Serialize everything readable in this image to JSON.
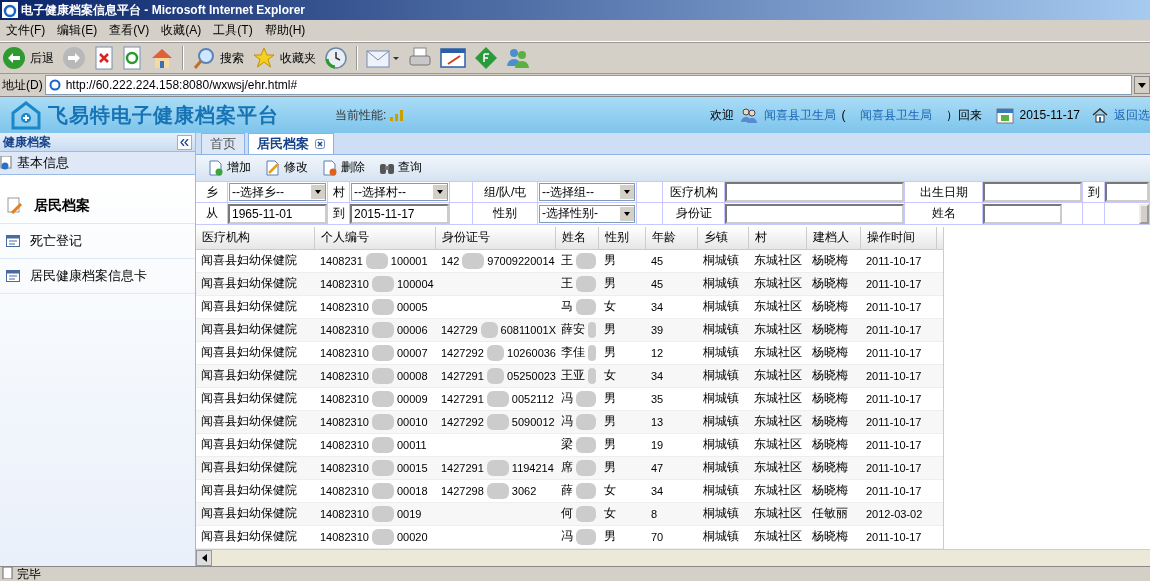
{
  "window": {
    "title": "电子健康档案信息平台 - Microsoft Internet Explorer"
  },
  "menu": [
    "文件(F)",
    "编辑(E)",
    "查看(V)",
    "收藏(A)",
    "工具(T)",
    "帮助(H)"
  ],
  "toolbar": [
    {
      "kind": "back",
      "label": "后退"
    },
    {
      "kind": "forward"
    },
    {
      "kind": "stop"
    },
    {
      "kind": "refresh"
    },
    {
      "kind": "home"
    },
    {
      "kind": "search",
      "label": "搜索"
    },
    {
      "kind": "favorites",
      "label": "收藏夹"
    },
    {
      "kind": "history"
    },
    {
      "kind": "mail"
    },
    {
      "kind": "print"
    },
    {
      "kind": "edit"
    },
    {
      "kind": "plugin"
    },
    {
      "kind": "messenger"
    }
  ],
  "address": {
    "label": "地址(D)",
    "url": "http://60.222.224.158:8080/wxwsj/ehr.html#"
  },
  "header": {
    "logo_text": "飞易特电子健康档案平台",
    "performance_label": "当前性能:",
    "welcome": "欢迎",
    "user": "闻喜县卫生局",
    "paren_open": "(",
    "org": "闻喜县卫生局",
    "paren_close": "）回来",
    "date": "2015-11-17",
    "back_link": "返回选"
  },
  "sidebar": {
    "title": "健康档案",
    "group": "基本信息",
    "items": [
      {
        "label": "居民档案",
        "selected": true
      },
      {
        "label": "死亡登记",
        "selected": false
      },
      {
        "label": "居民健康档案信息卡",
        "selected": false
      }
    ]
  },
  "tabs": [
    {
      "label": "首页",
      "selected": false,
      "closable": false
    },
    {
      "label": "居民档案",
      "selected": true,
      "closable": true
    }
  ],
  "actions": [
    {
      "kind": "add",
      "label": "增加"
    },
    {
      "kind": "edit",
      "label": "修改"
    },
    {
      "kind": "delete",
      "label": "删除"
    },
    {
      "kind": "query",
      "label": "查询"
    }
  ],
  "filters": [
    [
      {
        "kind": "label",
        "text": "乡"
      },
      {
        "kind": "select",
        "value": "--选择乡--"
      },
      {
        "kind": "label",
        "text": "村"
      },
      {
        "kind": "select",
        "value": "--选择村--"
      },
      {
        "kind": "blank"
      },
      {
        "kind": "label",
        "text": "组/队/屯"
      },
      {
        "kind": "select",
        "value": "--选择组--"
      },
      {
        "kind": "blank"
      },
      {
        "kind": "label",
        "text": "医疗机构"
      },
      {
        "kind": "input"
      },
      {
        "kind": "label",
        "text": "出生日期"
      },
      {
        "kind": "input"
      },
      {
        "kind": "label",
        "text": "到"
      },
      {
        "kind": "input"
      }
    ],
    [
      {
        "kind": "label",
        "text": "从"
      },
      {
        "kind": "input",
        "value": "1965-11-01"
      },
      {
        "kind": "label",
        "text": "到"
      },
      {
        "kind": "input",
        "value": "2015-11-17"
      },
      {
        "kind": "blank"
      },
      {
        "kind": "label",
        "text": "性别"
      },
      {
        "kind": "select",
        "value": "-选择性别-"
      },
      {
        "kind": "blank"
      },
      {
        "kind": "label",
        "text": "身份证"
      },
      {
        "kind": "input"
      },
      {
        "kind": "label",
        "text": "姓名"
      },
      {
        "kind": "input"
      },
      {
        "kind": "blank"
      },
      {
        "kind": "button"
      }
    ]
  ],
  "table": {
    "columns": [
      "医疗机构",
      "个人编号",
      "身份证号",
      "姓名",
      "性别",
      "年龄",
      "乡镇",
      "村",
      "建档人",
      "操作时间"
    ],
    "rows": [
      [
        "闻喜县妇幼保健院",
        [
          "1408231",
          "100001"
        ],
        [
          "142",
          "97009220014"
        ],
        "王",
        "男",
        "45",
        "桐城镇",
        "东城社区",
        "杨晓梅",
        "2011-10-17"
      ],
      [
        "闻喜县妇幼保健院",
        [
          "14082310",
          "100004"
        ],
        [],
        "王",
        "男",
        "45",
        "桐城镇",
        "东城社区",
        "杨晓梅",
        "2011-10-17"
      ],
      [
        "闻喜县妇幼保健院",
        [
          "14082310",
          "00005"
        ],
        [],
        "马",
        "女",
        "34",
        "桐城镇",
        "东城社区",
        "杨晓梅",
        "2011-10-17"
      ],
      [
        "闻喜县妇幼保健院",
        [
          "14082310",
          "00006"
        ],
        [
          "142729",
          "60811001X"
        ],
        "薛安",
        "男",
        "39",
        "桐城镇",
        "东城社区",
        "杨晓梅",
        "2011-10-17"
      ],
      [
        "闻喜县妇幼保健院",
        [
          "14082310",
          "00007"
        ],
        [
          "1427292",
          "10260036"
        ],
        "李佳",
        "男",
        "12",
        "桐城镇",
        "东城社区",
        "杨晓梅",
        "2011-10-17"
      ],
      [
        "闻喜县妇幼保健院",
        [
          "14082310",
          "00008"
        ],
        [
          "1427291",
          "05250023"
        ],
        "王亚",
        "女",
        "34",
        "桐城镇",
        "东城社区",
        "杨晓梅",
        "2011-10-17"
      ],
      [
        "闻喜县妇幼保健院",
        [
          "14082310",
          "00009"
        ],
        [
          "1427291",
          "0052112"
        ],
        "冯",
        "男",
        "35",
        "桐城镇",
        "东城社区",
        "杨晓梅",
        "2011-10-17"
      ],
      [
        "闻喜县妇幼保健院",
        [
          "14082310",
          "00010"
        ],
        [
          "1427292",
          "5090012"
        ],
        "冯",
        "男",
        "13",
        "桐城镇",
        "东城社区",
        "杨晓梅",
        "2011-10-17"
      ],
      [
        "闻喜县妇幼保健院",
        [
          "14082310",
          "00011"
        ],
        [],
        "梁",
        "男",
        "19",
        "桐城镇",
        "东城社区",
        "杨晓梅",
        "2011-10-17"
      ],
      [
        "闻喜县妇幼保健院",
        [
          "14082310",
          "00015"
        ],
        [
          "1427291",
          "1194214"
        ],
        "席",
        "男",
        "47",
        "桐城镇",
        "东城社区",
        "杨晓梅",
        "2011-10-17"
      ],
      [
        "闻喜县妇幼保健院",
        [
          "14082310",
          "00018"
        ],
        [
          "1427298",
          "3062"
        ],
        "薛",
        "女",
        "34",
        "桐城镇",
        "东城社区",
        "杨晓梅",
        "2011-10-17"
      ],
      [
        "闻喜县妇幼保健院",
        [
          "14082310",
          "0019"
        ],
        [],
        "何",
        "女",
        "8",
        "桐城镇",
        "东城社区",
        "任敏丽",
        "2012-03-02"
      ],
      [
        "闻喜县妇幼保健院",
        [
          "14082310",
          "00020"
        ],
        [],
        "冯",
        "男",
        "70",
        "桐城镇",
        "东城社区",
        "杨晓梅",
        "2011-10-17"
      ]
    ]
  },
  "status_bar": {
    "text": "完毕"
  }
}
